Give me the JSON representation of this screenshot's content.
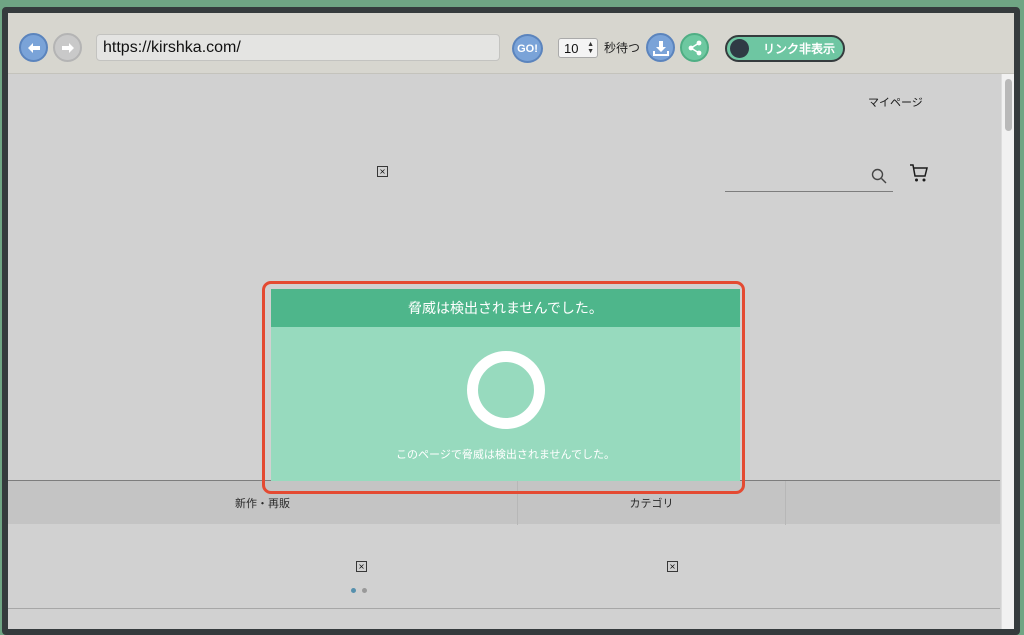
{
  "toolbar": {
    "url": "https://kirshka.com/",
    "go_label": "GO!",
    "wait_value": "10",
    "wait_label": "秒待つ",
    "toggle_label": "リンク非表示"
  },
  "page": {
    "mypage_label": "マイページ",
    "nav": [
      "新作・再販",
      "カテゴリ"
    ]
  },
  "dialog": {
    "title": "脅威は検出されませんでした。",
    "message": "このページで脅威は検出されませんでした。"
  },
  "colors": {
    "dialog_header": "#4eb68b",
    "dialog_body": "#97dabe",
    "highlight": "#e44a32",
    "toggle": "#6ec6a2"
  }
}
